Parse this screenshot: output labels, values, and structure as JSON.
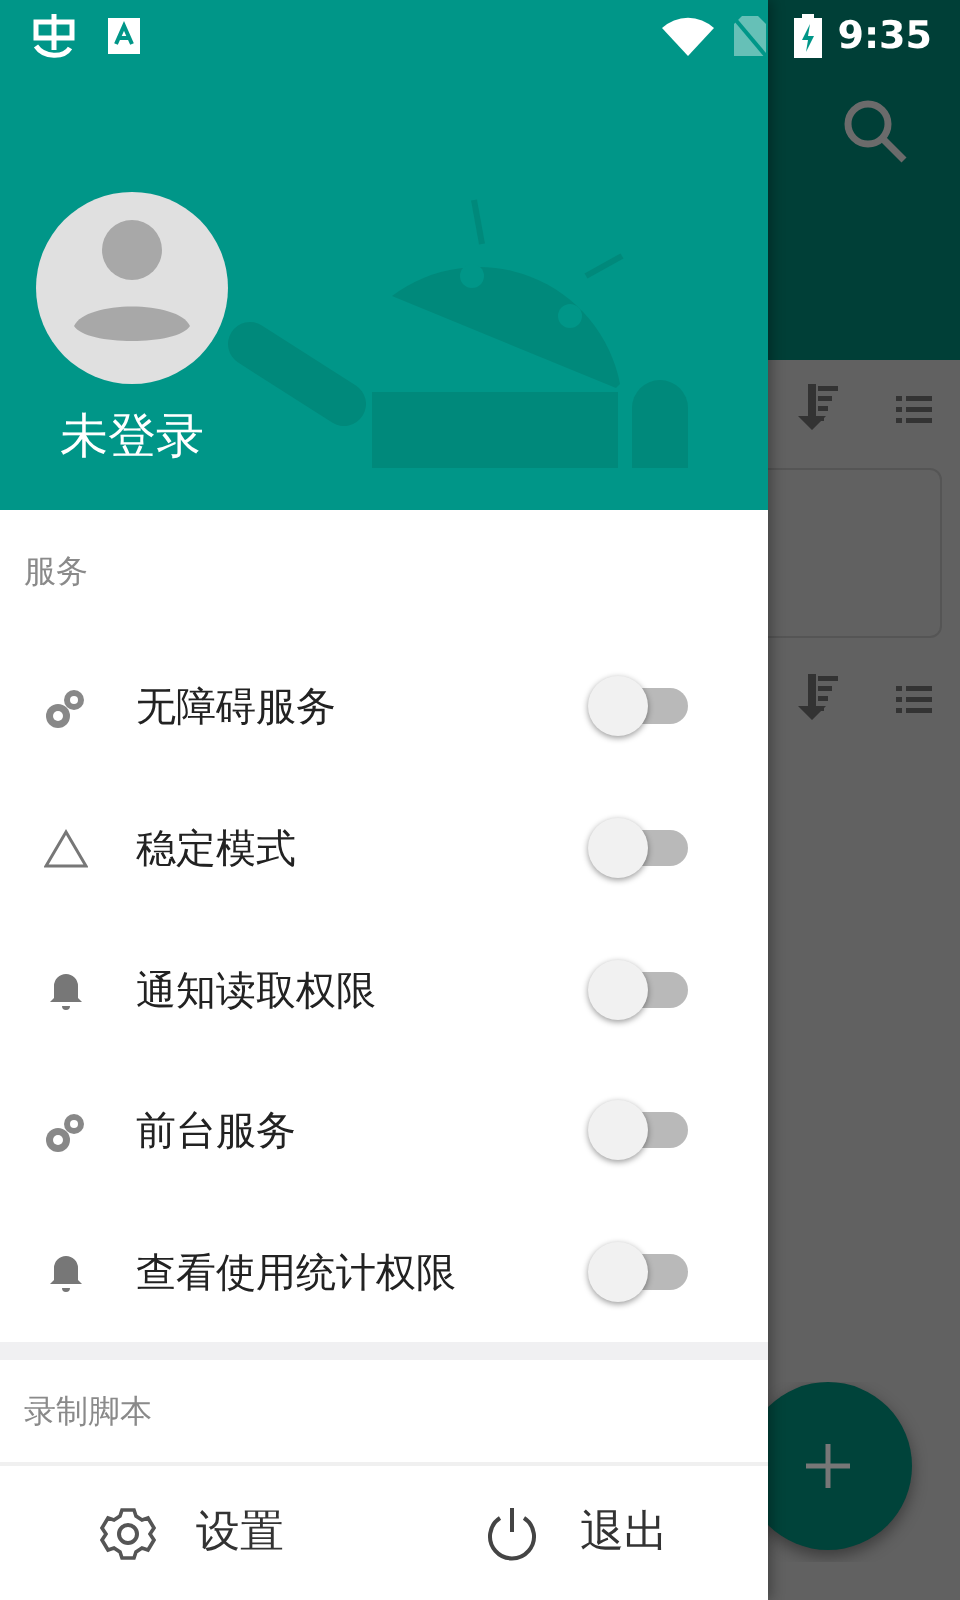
{
  "status_bar": {
    "time": "9:35"
  },
  "drawer": {
    "user": {
      "name": "未登录"
    },
    "sections": [
      {
        "title": "服务",
        "items": [
          {
            "label": "无障碍服务",
            "kind": "gears",
            "on": false
          },
          {
            "label": "稳定模式",
            "kind": "triangle",
            "on": false
          },
          {
            "label": "通知读取权限",
            "kind": "bell",
            "on": false
          },
          {
            "label": "前台服务",
            "kind": "gears",
            "on": false
          },
          {
            "label": "查看使用统计权限",
            "kind": "bell",
            "on": false
          }
        ]
      },
      {
        "title": "录制脚本"
      }
    ],
    "footer": [
      {
        "label": "设置",
        "kind": "settings"
      },
      {
        "label": "退出",
        "kind": "power"
      }
    ]
  }
}
